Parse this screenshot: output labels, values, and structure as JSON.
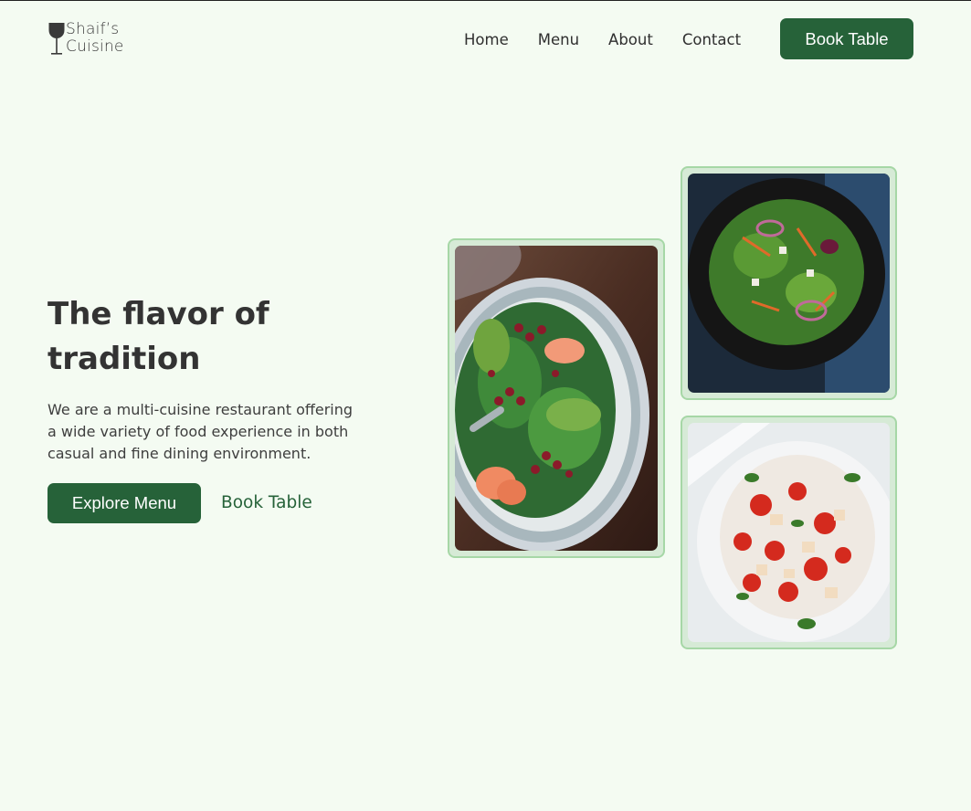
{
  "brand": {
    "line1": "Shaif’s",
    "line2": "Cuisine",
    "icon": "wine-glass-icon"
  },
  "nav": {
    "items": [
      "Home",
      "Menu",
      "About",
      "Contact"
    ],
    "book_label": "Book Table"
  },
  "hero": {
    "title": "The flavor of tradition",
    "description": "We are a multi-cuisine restaurant offering a wide variety of food experience in both casual and fine dining environment.",
    "primary_cta": "Explore Menu",
    "secondary_cta": "Book Table"
  },
  "images": [
    {
      "name": "spinach-pomegranate-salad-photo"
    },
    {
      "name": "dark-bowl-salad-photo"
    },
    {
      "name": "tomato-panzanella-salad-photo"
    }
  ],
  "colors": {
    "background": "#f4fbf2",
    "accent": "#266239",
    "card_border": "#a6d7a6"
  }
}
